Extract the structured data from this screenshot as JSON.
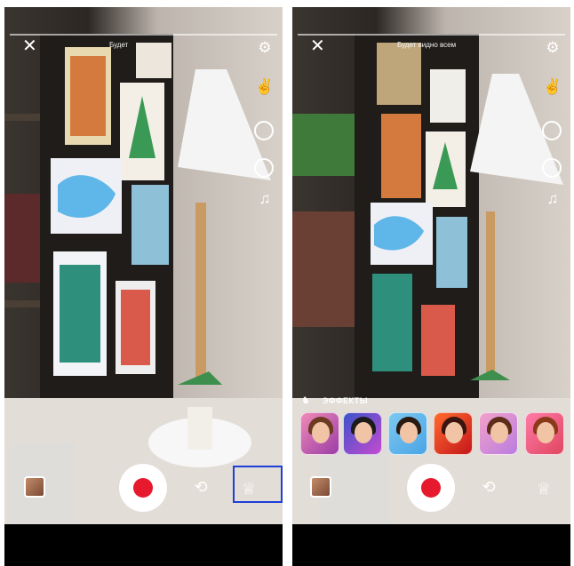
{
  "screens": [
    {
      "top_label": "Будет",
      "top_label_visible": true,
      "effects_panel": false,
      "effects_button_highlighted": true
    },
    {
      "top_label": "Будет видно всем",
      "top_label_visible": true,
      "effects_panel": true,
      "effects_title": "ЭФФЕКТЫ",
      "effects": [
        {
          "name": "effect-1"
        },
        {
          "name": "effect-2"
        },
        {
          "name": "effect-3"
        },
        {
          "name": "effect-4"
        },
        {
          "name": "effect-5"
        },
        {
          "name": "effect-6"
        }
      ]
    }
  ],
  "colors": {
    "record": "#e6192d",
    "highlight": "#1e3fd8"
  },
  "icons": [
    "close-icon",
    "settings-icon",
    "gesture-icon",
    "timer-icon",
    "speed-icon",
    "music-icon",
    "record-icon",
    "switch-camera-icon",
    "effects-icon",
    "gallery-thumbnail"
  ]
}
